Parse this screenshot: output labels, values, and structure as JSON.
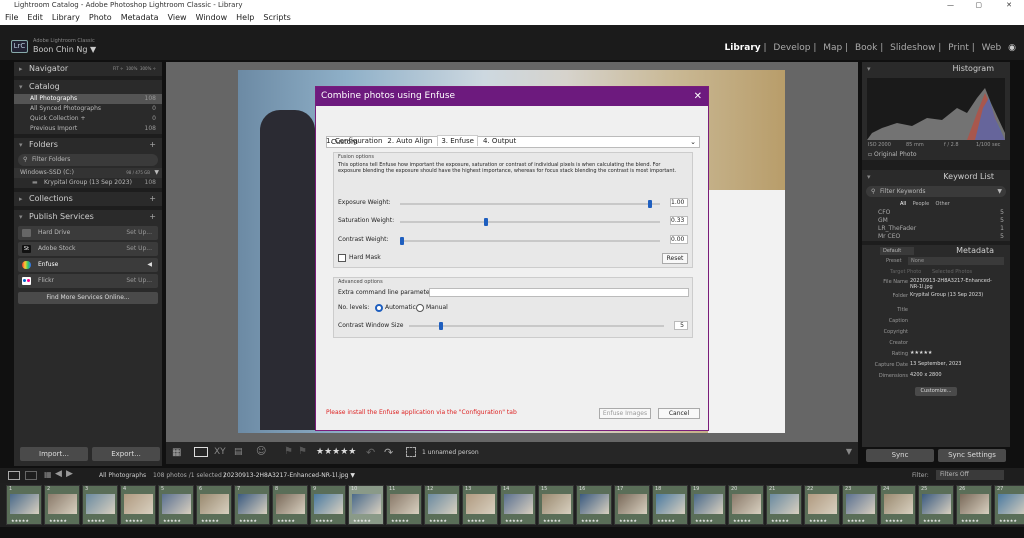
{
  "window": {
    "title": "Lightroom Catalog - Adobe Photoshop Lightroom Classic - Library"
  },
  "menu": [
    "File",
    "Edit",
    "Library",
    "Photo",
    "Metadata",
    "View",
    "Window",
    "Help",
    "Scripts"
  ],
  "identity": {
    "app": "Adobe Lightroom Classic",
    "user": "Boon Chin Ng ▼",
    "logo": "LrC"
  },
  "modules": [
    "Library",
    "Develop",
    "Map",
    "Book",
    "Slideshow",
    "Print",
    "Web"
  ],
  "left": {
    "navigator": {
      "title": "Navigator",
      "zoom": [
        "FIT ÷",
        "100%",
        "300% ÷"
      ]
    },
    "catalog": {
      "title": "Catalog",
      "items": [
        {
          "label": "All Photographs",
          "count": "108"
        },
        {
          "label": "All Synced Photographs",
          "count": "0"
        },
        {
          "label": "Quick Collection +",
          "count": "0"
        },
        {
          "label": "Previous Import",
          "count": "108"
        }
      ]
    },
    "folders": {
      "title": "Folders",
      "filter": "Filter Folders",
      "volume": "Windows-SSD (C:)",
      "volume_size": "98 / 475 GB",
      "folder": "Krypital Group (13 Sep 2023)",
      "folder_count": "108"
    },
    "collections": {
      "title": "Collections"
    },
    "publish": {
      "title": "Publish Services",
      "items": [
        {
          "label": "Hard Drive",
          "action": "Set Up..."
        },
        {
          "label": "Adobe Stock",
          "action": "Set Up..."
        },
        {
          "label": "Enfuse",
          "action": "◀"
        },
        {
          "label": "Flickr",
          "action": "Set Up..."
        }
      ],
      "find_more": "Find More Services Online..."
    },
    "import": "Import...",
    "export": "Export..."
  },
  "dialog": {
    "title": "Combine photos using Enfuse",
    "preset": "Custom",
    "tabs": [
      "1. Configuration",
      "2. Auto Align",
      "3. Enfuse",
      "4. Output"
    ],
    "fusion_label": "Fusion options",
    "fusion_desc": "This options tell Enfuse how important the exposure, saturation or contrast of individual pixels is when calculating the blend. For exposure blending the exposure should have the highest importance, whereas for focus stack blending the contrast is most important.",
    "exposure_label": "Exposure Weight:",
    "exposure": "1.00",
    "saturation_label": "Saturation Weight:",
    "saturation": "0.33",
    "contrast_label": "Contrast Weight:",
    "contrast": "0.00",
    "hardmask": "Hard Mask",
    "reset": "Reset",
    "advanced_label": "Advanced options",
    "extra_label": "Extra command line parameters:",
    "levels_label": "No. levels:",
    "levels_auto": "Automatic",
    "levels_manual": "Manual",
    "cws_label": "Contrast Window Size",
    "cws": "5",
    "warning": "Please install the Enfuse application via the \"Configuration\" tab",
    "enfuse_btn": "Enfuse Images",
    "cancel_btn": "Cancel",
    "sliders": {
      "exposure_frac": 0.97,
      "saturation_frac": 0.33,
      "contrast_frac": 0.0,
      "cws_frac": 0.12
    }
  },
  "toolbar": {
    "stars": "★★★★★",
    "faces": "1 unnamed person"
  },
  "filmstrip_header": {
    "source": "All Photographs",
    "info": "108 photos /1 selected /",
    "file": "20230913-2H8A3217-Enhanced-NR-1l.jpg ▼",
    "filter_label": "Filter:",
    "filter": "Filters Off"
  },
  "right": {
    "histogram": {
      "title": "Histogram",
      "iso": "ISO 2000",
      "focal": "85 mm",
      "aperture": "f / 2.8",
      "shutter": "1/100 sec",
      "original": "Original Photo"
    },
    "keywords": {
      "title": "Keyword List",
      "filter": "Filter Keywords",
      "tabs": [
        "All",
        "People",
        "Other"
      ],
      "items": [
        {
          "label": "CFO",
          "count": "5"
        },
        {
          "label": "GM",
          "count": "5"
        },
        {
          "label": "LR_TheFader",
          "count": "1"
        },
        {
          "label": "Mr CEO",
          "count": "5"
        }
      ]
    },
    "metadata": {
      "title": "Metadata",
      "preset_sel": "Default",
      "preset_label": "Preset",
      "preset_val": "None",
      "target": "Target Photo",
      "selected": "Selected Photos",
      "fields": [
        {
          "k": "File Name",
          "v": "20230913-2H8A3217-Enhanced-NR-1l.jpg"
        },
        {
          "k": "Folder",
          "v": "Krypital Group (13 Sep 2023)"
        },
        {
          "k": "Title",
          "v": ""
        },
        {
          "k": "Caption",
          "v": ""
        },
        {
          "k": "Copyright",
          "v": ""
        },
        {
          "k": "Creator",
          "v": ""
        },
        {
          "k": "Rating",
          "v": "★★★★★"
        },
        {
          "k": "Capture Date",
          "v": "13 September, 2023"
        },
        {
          "k": "Dimensions",
          "v": "4200 x 2800"
        }
      ],
      "customize": "Customize..."
    },
    "sync": "Sync",
    "sync_settings": "Sync Settings"
  },
  "filmstrip": [
    {
      "n": "1"
    },
    {
      "n": "2"
    },
    {
      "n": "3"
    },
    {
      "n": "4"
    },
    {
      "n": "5"
    },
    {
      "n": "6"
    },
    {
      "n": "7"
    },
    {
      "n": "8"
    },
    {
      "n": "9"
    },
    {
      "n": "10"
    },
    {
      "n": "11"
    },
    {
      "n": "12"
    },
    {
      "n": "13"
    },
    {
      "n": "14"
    },
    {
      "n": "15"
    },
    {
      "n": "16"
    },
    {
      "n": "17"
    },
    {
      "n": "18"
    },
    {
      "n": "19"
    },
    {
      "n": "20"
    },
    {
      "n": "21"
    },
    {
      "n": "22"
    },
    {
      "n": "23"
    },
    {
      "n": "24"
    },
    {
      "n": "25"
    },
    {
      "n": "26"
    },
    {
      "n": "27"
    }
  ]
}
